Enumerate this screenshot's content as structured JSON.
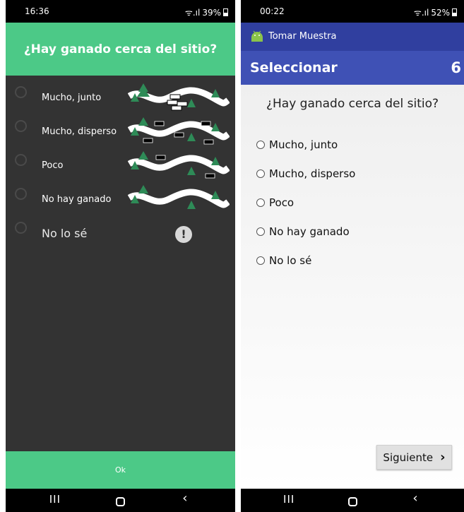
{
  "left": {
    "status": {
      "time": "16:36",
      "signal": "ᯤ.ıl",
      "battery_pct": "39%"
    },
    "question": "¿Hay ganado cerca del sitio?",
    "options": [
      {
        "label": "Mucho, junto"
      },
      {
        "label": "Mucho, disperso"
      },
      {
        "label": "Poco"
      },
      {
        "label": "No hay ganado"
      },
      {
        "label": "No lo sé"
      }
    ],
    "alert_glyph": "!",
    "ok_label": "Ok",
    "nav": {
      "recents": "III",
      "back": "‹"
    }
  },
  "right": {
    "status": {
      "time": "00:22",
      "signal": "ᯤ.ıl",
      "battery_pct": "52%"
    },
    "app_title": "Tomar Muestra",
    "toolbar_title": "Seleccionar",
    "step_number": "6",
    "question": "¿Hay ganado cerca del sitio?",
    "options": [
      {
        "label": "Mucho, junto"
      },
      {
        "label": "Mucho, disperso"
      },
      {
        "label": "Poco"
      },
      {
        "label": "No hay ganado"
      },
      {
        "label": "No lo sé"
      }
    ],
    "next_label": "Siguiente",
    "next_glyph": "›",
    "nav": {
      "recents": "III",
      "back": "‹"
    }
  },
  "colors": {
    "green": "#4cc987",
    "dark_bg": "#333333",
    "indigo": "#3f51b5",
    "indigo_dark": "#303f9f",
    "tree": "#2e8b57"
  }
}
